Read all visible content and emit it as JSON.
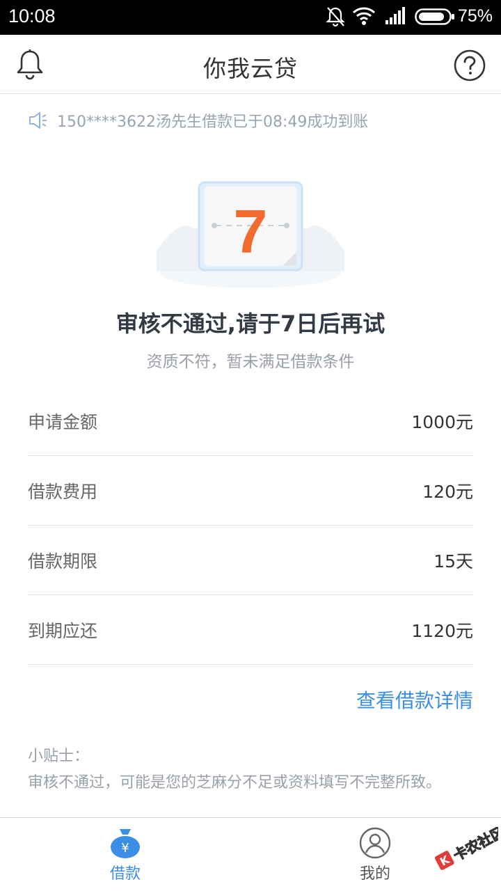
{
  "status_bar": {
    "time": "10:08",
    "battery": "75%"
  },
  "header": {
    "title": "你我云贷"
  },
  "notice": {
    "text": "150****3622汤先生借款已于08:49成功到账"
  },
  "illustration": {
    "calendar_number": "7"
  },
  "result": {
    "title": "审核不通过,请于7日后再试",
    "subtitle": "资质不符，暂未满足借款条件"
  },
  "details": [
    {
      "label": "申请金额",
      "value": "1000元"
    },
    {
      "label": "借款费用",
      "value": "120元"
    },
    {
      "label": "借款期限",
      "value": "15天"
    },
    {
      "label": "到期应还",
      "value": "1120元"
    }
  ],
  "detail_link": "查看借款详情",
  "tips": {
    "title": "小贴士：",
    "body": "审核不通过，可能是您的芝麻分不足或资料填写不完整所致。"
  },
  "tabs": [
    {
      "label": "借款",
      "active": true
    },
    {
      "label": "我的",
      "active": false
    }
  ],
  "watermark": {
    "text": "卡农社区"
  },
  "colors": {
    "accent": "#3a8ee6",
    "calendar_number": "#f26b2e",
    "muted_text": "#9aa0a8"
  }
}
